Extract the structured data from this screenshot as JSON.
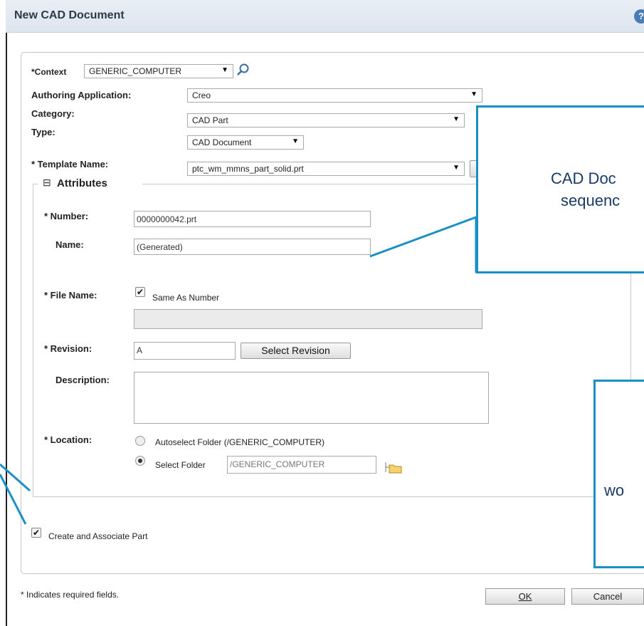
{
  "dialog": {
    "title": "New CAD Document",
    "help_icon": "help-icon"
  },
  "form": {
    "context": {
      "label": "*Context",
      "value": "GENERIC_COMPUTER",
      "icon": "search-icon"
    },
    "authoring": {
      "label": "Authoring Application:",
      "value": "Creo"
    },
    "category": {
      "label": "Category:",
      "value": "CAD Part"
    },
    "type": {
      "label": "Type:",
      "value": "CAD Document"
    },
    "template": {
      "label": "* Template Name:",
      "value": "ptc_wm_mmns_part_solid.prt"
    }
  },
  "attributes": {
    "legend": "Attributes",
    "collapse_icon": "⊟",
    "number": {
      "label": "* Number:",
      "value": "0000000042.prt"
    },
    "name": {
      "label": "Name:",
      "value": "(Generated)"
    },
    "file_name": {
      "label": "* File Name:",
      "checkbox_label": "Same As Number",
      "checked": true
    },
    "revision": {
      "label": "* Revision:",
      "value": "A",
      "button": "Select Revision"
    },
    "description": {
      "label": "Description:"
    },
    "location": {
      "label": "* Location:",
      "autoselect": "Autoselect Folder (/GENERIC_COMPUTER)",
      "select": "Select Folder",
      "folder_value": "/GENERIC_COMPUTER",
      "folder_icon": "folder-icon"
    }
  },
  "create_part": {
    "label": "Create and Associate Part",
    "checked": true
  },
  "footer": {
    "note": "* Indicates required fields.",
    "ok": "OK",
    "cancel": "Cancel"
  },
  "callouts": {
    "top": {
      "line1": "CAD Doc",
      "line2": "sequenc"
    },
    "bottom": {
      "line1": "wo"
    }
  },
  "colors": {
    "callout_border": "#1a8fc7",
    "callout_text": "#1a3a66"
  }
}
